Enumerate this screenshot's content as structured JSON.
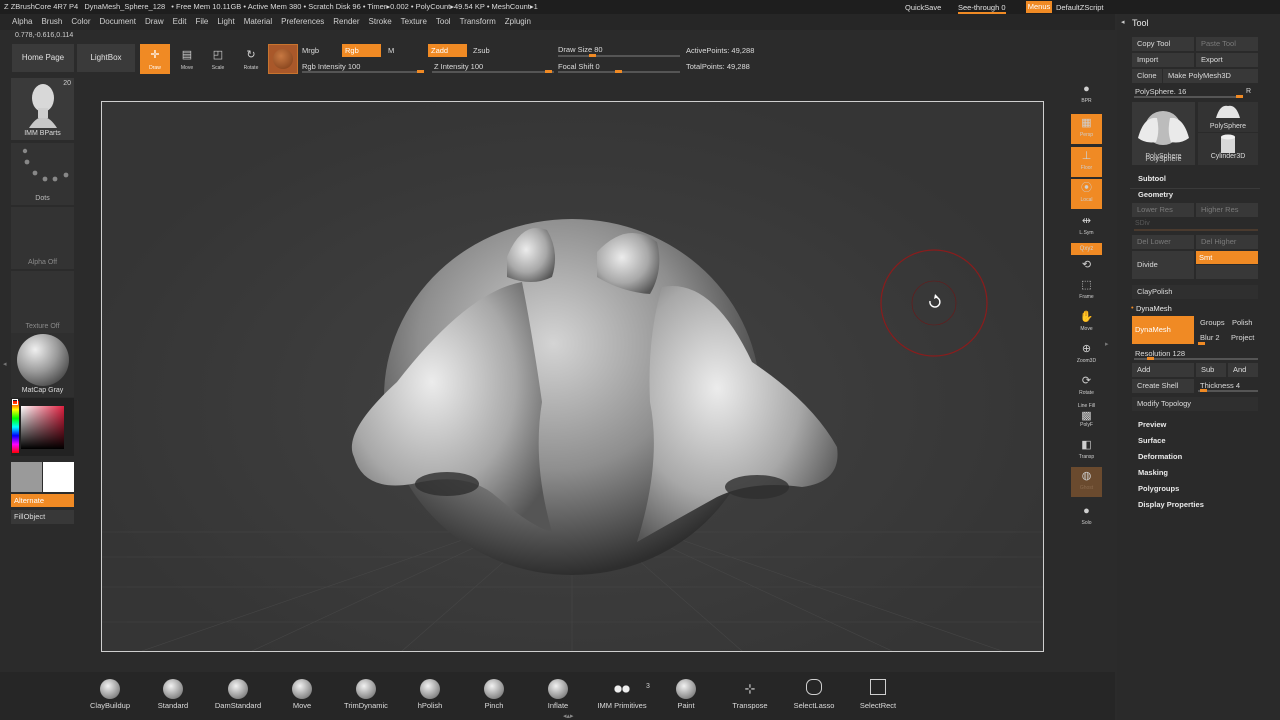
{
  "titlebar": {
    "app": "ZBrushCore 4R7 P4",
    "document": "DynaMesh_Sphere_128",
    "stats": "• Free Mem 10.11GB • Active Mem 380 • Scratch Disk 96 • Timer▸0.002 • PolyCount▸49.54 KP • MeshCount▸1",
    "quicksave": "QuickSave",
    "see_through": "See-through  0",
    "menus": "Menus",
    "script": "DefaultZScript"
  },
  "menu": [
    "Alpha",
    "Brush",
    "Color",
    "Document",
    "Draw",
    "Edit",
    "File",
    "Light",
    "Material",
    "Preferences",
    "Render",
    "Stroke",
    "Texture",
    "Tool",
    "Transform",
    "Zplugin"
  ],
  "coords": "0.778,-0.616,0.114",
  "toolbar": {
    "home": "Home Page",
    "lightbox": "LightBox",
    "draw": "Draw",
    "move": "Move",
    "scale": "Scale",
    "rotate": "Rotate",
    "mrgb": "Mrgb",
    "rgb": "Rgb",
    "m": "M",
    "rgb_intensity": "Rgb Intensity 100",
    "zadd": "Zadd",
    "zsub": "Zsub",
    "z_intensity": "Z Intensity 100",
    "draw_size": "Draw Size 80",
    "focal_shift": "Focal Shift 0",
    "active_points": "ActivePoints: 49,288",
    "total_points": "TotalPoints: 49,288"
  },
  "left": {
    "brush_count": "20",
    "brush": "IMM BParts",
    "stroke": "Dots",
    "alpha": "Alpha Off",
    "texture": "Texture Off",
    "material": "MatCap Gray",
    "alternate": "Alternate",
    "fill": "FillObject"
  },
  "right_icons": [
    "BPR",
    "Persp",
    "Floor",
    "Local",
    "L.Sym",
    "Qxyz",
    "Frame",
    "Move",
    "Zoom3D",
    "Rotate",
    "PolyF",
    "Transp",
    "Ghost",
    "Solo"
  ],
  "right_icons_extra": {
    "line_fill": "Line Fill"
  },
  "tool": {
    "title": "Tool",
    "copy": "Copy Tool",
    "paste": "Paste Tool",
    "import": "Import",
    "export": "Export",
    "clone": "Clone",
    "make": "Make PolyMesh3D",
    "slider": "PolySphere. 16",
    "slider_r": "R",
    "thumb1": "PolySphere",
    "thumb2": "PolySphere",
    "thumb3": "PolySphere",
    "thumb4": "Cylinder3D",
    "subtool": "Subtool",
    "geometry": "Geometry",
    "lower_res": "Lower Res",
    "higher_res": "Higher Res",
    "sdiv": "SDiv",
    "del_lower": "Del Lower",
    "del_higher": "Del Higher",
    "divide": "Divide",
    "smt": "Smt",
    "claypolish": "ClayPolish",
    "dynamesh_section": "DynaMesh",
    "dynamesh_btn": "DynaMesh",
    "groups": "Groups",
    "polish": "Polish",
    "blur": "Blur 2",
    "project": "Project",
    "resolution": "Resolution 128",
    "add": "Add",
    "sub": "Sub",
    "and": "And",
    "create_shell": "Create Shell",
    "thickness": "Thickness 4",
    "modify_topology": "Modify Topology",
    "preview": "Preview",
    "surface": "Surface",
    "deformation": "Deformation",
    "masking": "Masking",
    "polygroups": "Polygroups",
    "display_properties": "Display Properties"
  },
  "bottom_brushes": [
    {
      "label": "ClayBuildup",
      "icon": "claybuildup-icon"
    },
    {
      "label": "Standard",
      "icon": "standard-icon"
    },
    {
      "label": "DamStandard",
      "icon": "damstandard-icon"
    },
    {
      "label": "Move",
      "icon": "move-brush-icon"
    },
    {
      "label": "TrimDynamic",
      "icon": "trimdynamic-icon"
    },
    {
      "label": "hPolish",
      "icon": "hpolish-icon"
    },
    {
      "label": "Pinch",
      "icon": "pinch-icon"
    },
    {
      "label": "Inflate",
      "icon": "inflate-icon"
    },
    {
      "label": "IMM Primitives",
      "icon": "imm-primitives-icon"
    },
    {
      "label": "Paint",
      "icon": "paint-icon"
    },
    {
      "label": "Transpose",
      "icon": "transpose-icon"
    },
    {
      "label": "SelectLasso",
      "icon": "selectlasso-icon"
    },
    {
      "label": "SelectRect",
      "icon": "selectrect-icon"
    }
  ],
  "imm_count": "3",
  "colors": {
    "accent": "#f08a24",
    "canvas": "#3b3b3b",
    "panel": "#2a2a2a"
  }
}
